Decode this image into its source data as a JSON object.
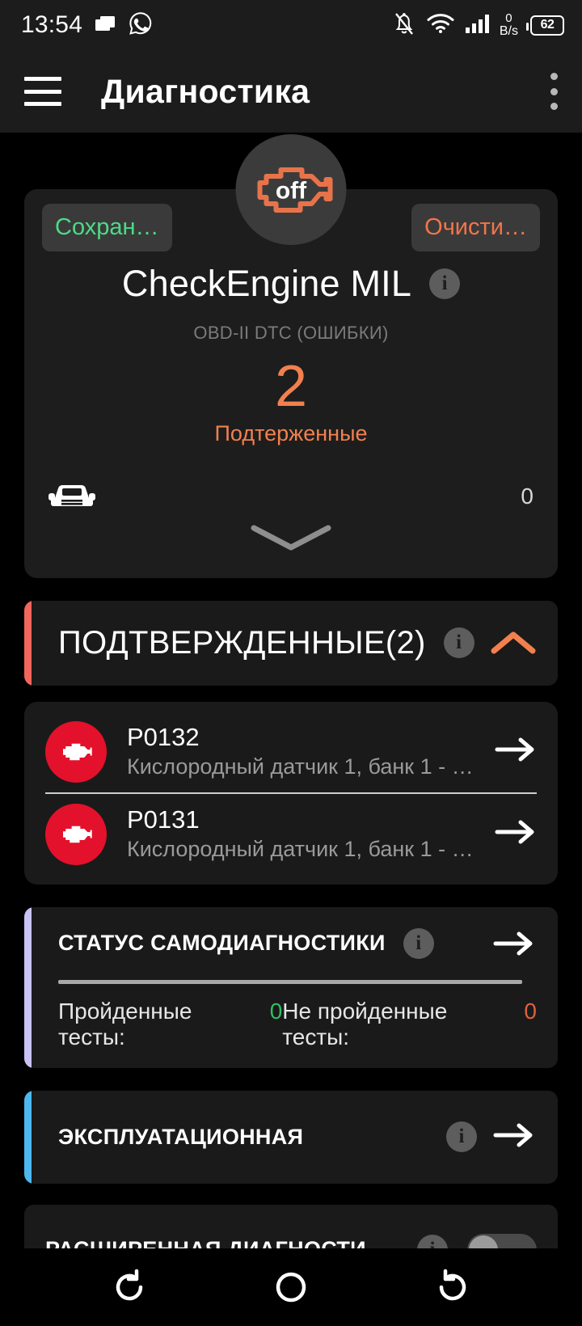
{
  "status_bar": {
    "time": "13:54",
    "icons": [
      "folder-icon",
      "whatsapp-icon"
    ],
    "right_icons": [
      "bell-muted-icon",
      "wifi-icon",
      "signal-icon"
    ],
    "data_rate_value": "0",
    "data_rate_unit": "B/s",
    "battery_percent": "62"
  },
  "app_bar": {
    "menu_icon": "hamburger-menu-icon",
    "title": "Диагностика",
    "overflow_icon": "overflow-menu-icon"
  },
  "hero": {
    "badge_label": "off",
    "badge_icon": "check-engine-icon",
    "save_label": "Сохран…",
    "clear_label": "Очисти…",
    "title": "CheckEngine MIL",
    "info_label": "i",
    "subtitle": "OBD-II DTC (ОШИБКИ)",
    "count": "2",
    "count_label": "Подтерженные",
    "car_icon": "car-front-icon",
    "car_value": "0",
    "expand_icon": "chevron-down-icon"
  },
  "confirmed_section": {
    "title": "ПОДТВЕРЖДЕННЫЕ(2)",
    "info_label": "i",
    "collapse_icon": "chevron-up-icon",
    "accent_color": "#f2665c",
    "items": [
      {
        "code": "P0132",
        "description": "Кислородный датчик 1, банк 1 - в…",
        "icon": "check-engine-icon",
        "arrow": "arrow-right-icon"
      },
      {
        "code": "P0131",
        "description": "Кислородный датчик 1, банк 1 - н…",
        "icon": "check-engine-icon",
        "arrow": "arrow-right-icon"
      }
    ]
  },
  "self_diag_section": {
    "title": "СТАТУС САМОДИАГНОСТИКИ",
    "info_label": "i",
    "arrow": "arrow-right-icon",
    "accent_color": "#c9c2f5",
    "passed_label": "Пройденные тесты:",
    "passed_value": "0",
    "failed_label": "Не пройденные тесты:",
    "failed_value": "0"
  },
  "operational_section": {
    "title": "ЭКСПЛУАТАЦИОННАЯ",
    "info_label": "i",
    "arrow": "arrow-right-icon",
    "accent_color": "#4db8f0"
  },
  "extended_section": {
    "title": "РАСШИРЕННАЯ ДИАГНОСТИ…",
    "info_label": "i",
    "toggle_state": "off"
  },
  "nav_bar": {
    "recents_icon": "recents-icon",
    "home_icon": "home-icon",
    "back_icon": "back-icon"
  }
}
